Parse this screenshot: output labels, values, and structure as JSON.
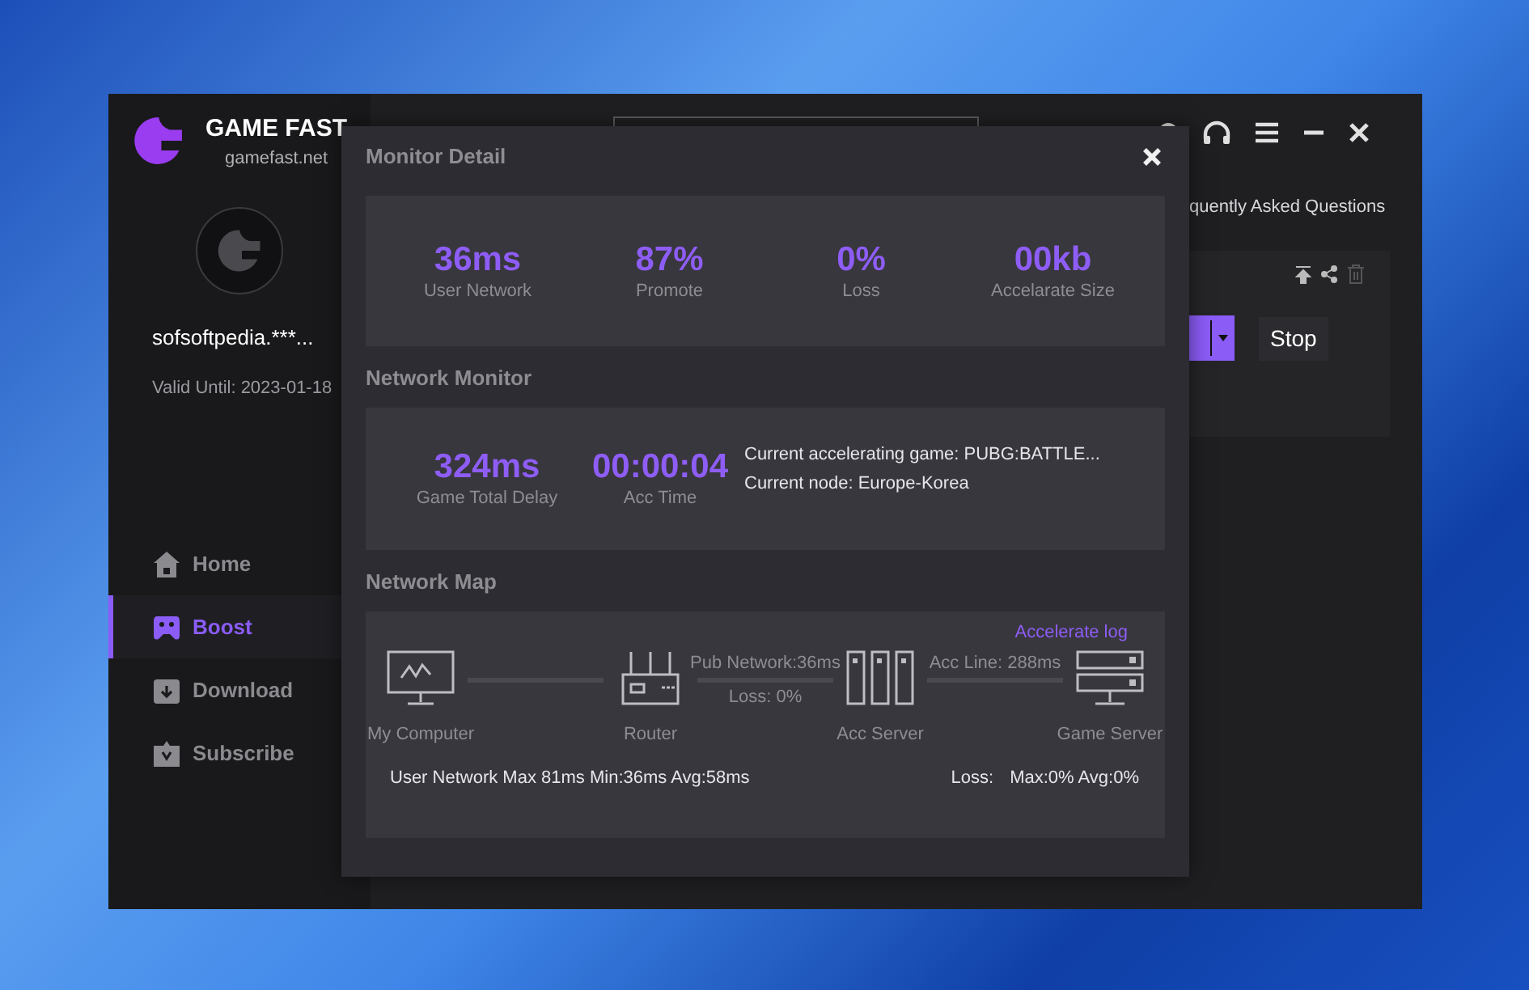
{
  "app": {
    "title": "GAME FAST",
    "site": "gamefast.net",
    "username": "sofsoftpedia.***...",
    "valid_until": "Valid Until: 2023-01-18"
  },
  "nav": [
    {
      "kind": "home",
      "label": "Home",
      "selected": false
    },
    {
      "kind": "boost",
      "label": "Boost",
      "selected": true
    },
    {
      "kind": "download",
      "label": "Download",
      "selected": false
    },
    {
      "kind": "subscribe",
      "label": "Subscribe",
      "selected": false
    }
  ],
  "main": {
    "faq_link": "quently Asked Questions",
    "stop_button": "Stop"
  },
  "dialog": {
    "title": "Monitor Detail",
    "monitor_stats": [
      {
        "value": "36ms",
        "label": "User Network"
      },
      {
        "value": "87%",
        "label": "Promote"
      },
      {
        "value": "0%",
        "label": "Loss"
      },
      {
        "value": "00kb",
        "label": "Accelarate Size"
      }
    ],
    "network_monitor_title": "Network Monitor",
    "network_stats": [
      {
        "value": "324ms",
        "label": "Game Total Delay"
      },
      {
        "value": "00:00:04",
        "label": "Acc Time"
      }
    ],
    "current_game": "Current accelerating game: PUBG:BATTLE...",
    "current_node": "Current node: Europe-Korea",
    "network_map_title": "Network Map",
    "accelerate_log": "Accelerate log",
    "nodes": [
      {
        "kind": "computer",
        "label": "My Computer"
      },
      {
        "kind": "router",
        "label": "Router",
        "link_top": "Pub Network:36ms",
        "link_bottom": "Loss: 0%"
      },
      {
        "kind": "acc-server",
        "label": "Acc Server",
        "link_top": "Acc Line: 288ms"
      },
      {
        "kind": "game-server",
        "label": "Game Server"
      }
    ],
    "user_network_summary": "User Network Max 81ms Min:36ms Avg:58ms",
    "loss_label": "Loss:",
    "loss_summary": "Max:0% Avg:0%"
  }
}
